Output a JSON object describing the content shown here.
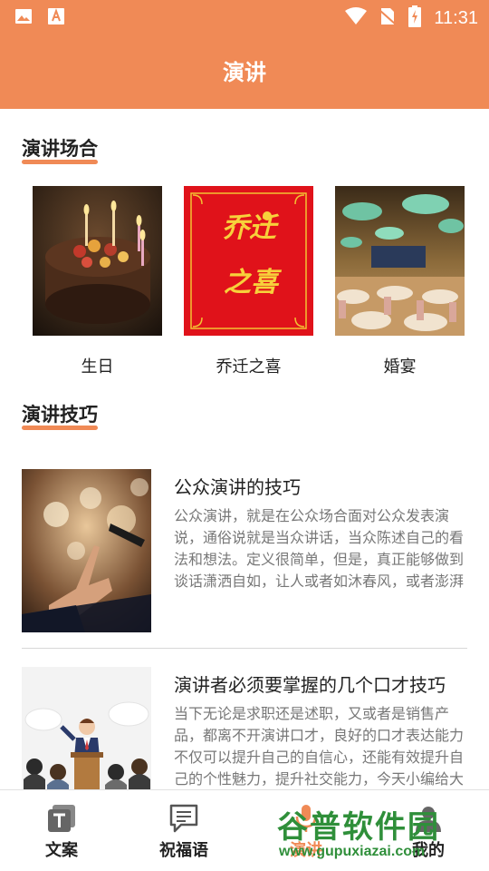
{
  "status_bar": {
    "time": "11:31",
    "icons": [
      "image-icon",
      "font-icon",
      "wifi-icon",
      "no-sim-icon",
      "battery-charging-icon"
    ]
  },
  "header": {
    "title": "演讲"
  },
  "occasions": {
    "title": "演讲场合",
    "items": [
      {
        "label": "生日",
        "image": "birthday-cake-image"
      },
      {
        "label": "乔迁之喜",
        "image": "housewarming-card-image",
        "image_text": "乔迁之喜"
      },
      {
        "label": "婚宴",
        "image": "wedding-banquet-image"
      }
    ]
  },
  "tips": {
    "title": "演讲技巧",
    "articles": [
      {
        "title": "公众演讲的技巧",
        "body": "公众演讲，就是在公众场合面对公众发表演说，通俗说就是当众讲话，当众陈述自己的看法和想法。定义很简单，但是，真正能够做到谈话潇洒自如，让人或者如沐春风，或者澎湃激昂等非常受感染的就…",
        "image": "speaker-hand-image"
      },
      {
        "title": "演讲者必须要掌握的几个口才技巧",
        "body": "当下无论是求职还是述职，又或者是销售产品，都离不开演讲口才，良好的口才表达能力不仅可以提升自己的自信心，还能有效提升自己的个性魅力，提升社交能力，今天小编给大伙儿带来几种提升演",
        "image": "speaker-podium-image"
      }
    ]
  },
  "bottom_nav": {
    "items": [
      {
        "label": "文案",
        "icon": "text-icon"
      },
      {
        "label": "祝福语",
        "icon": "message-icon"
      },
      {
        "label": "演讲",
        "icon": "speech-icon",
        "active": true
      },
      {
        "label": "我的",
        "icon": "profile-icon"
      }
    ]
  },
  "watermark": {
    "logo": "谷普软件园",
    "url": "www.gupuxiazai.com"
  },
  "colors": {
    "accent": "#f08a56",
    "text": "#222222",
    "muted": "#777777"
  }
}
